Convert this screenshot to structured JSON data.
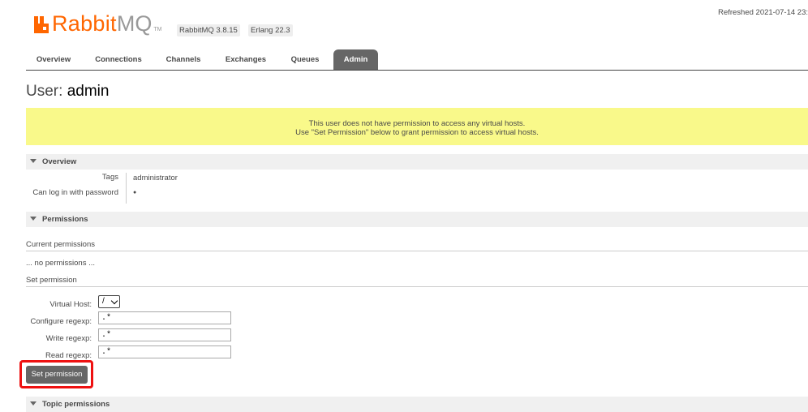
{
  "header": {
    "logo_rabbit": "Rabbit",
    "logo_mq": "MQ",
    "logo_tm": "TM",
    "version": "RabbitMQ 3.8.15",
    "erlang": "Erlang 22.3",
    "refreshed": "Refreshed 2021-07-14 23:"
  },
  "tabs": [
    {
      "label": "Overview"
    },
    {
      "label": "Connections"
    },
    {
      "label": "Channels"
    },
    {
      "label": "Exchanges"
    },
    {
      "label": "Queues"
    },
    {
      "label": "Admin",
      "active": true
    }
  ],
  "page": {
    "title_prefix": "User:",
    "title_name": "admin"
  },
  "warning": {
    "line1": "This user does not have permission to access any virtual hosts.",
    "line2": "Use \"Set Permission\" below to grant permission to access virtual hosts."
  },
  "overview": {
    "heading": "Overview",
    "tags_label": "Tags",
    "tags_value": "administrator",
    "login_label": "Can log in with password",
    "login_value": "●"
  },
  "permissions": {
    "heading": "Permissions",
    "current_heading": "Current permissions",
    "none_text": "... no permissions ...",
    "set_heading": "Set permission",
    "vhost_label": "Virtual Host:",
    "vhost_value": "/",
    "configure_label": "Configure regexp:",
    "configure_value": ".*",
    "write_label": "Write regexp:",
    "write_value": ".*",
    "read_label": "Read regexp:",
    "read_value": ".*",
    "button": "Set permission"
  },
  "topic": {
    "heading": "Topic permissions"
  },
  "colors": {
    "brand_orange": "#ff6600",
    "tab_active": "#666666",
    "warning_bg": "#f9f98a",
    "highlight": "#ee1111"
  }
}
